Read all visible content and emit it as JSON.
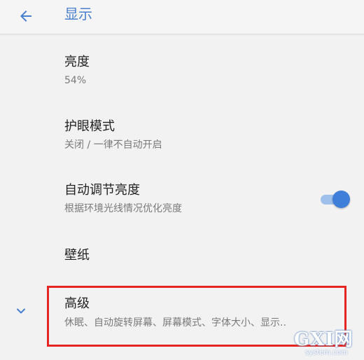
{
  "app_bar": {
    "title": "显示",
    "back_icon": "arrow-back-icon",
    "accent_color": "#4a7fd0"
  },
  "settings": {
    "brightness": {
      "title": "亮度",
      "value": "54%"
    },
    "night_light": {
      "title": "护眼模式",
      "summary": "关闭 / 一律不自动开启"
    },
    "adaptive_brightness": {
      "title": "自动调节亮度",
      "summary": "根据环境光线情况优化亮度",
      "toggle_on": true,
      "toggle_color": "#3f7fd9"
    },
    "wallpaper": {
      "title": "壁纸"
    },
    "advanced": {
      "title": "高级",
      "summary": "休眠、自动旋转屏幕、屏幕模式、字体大小、显示..",
      "expand_icon": "chevron-down-icon",
      "highlight_color": "#e52521"
    }
  },
  "watermark": {
    "text": "GXI网",
    "subtext": "system.com"
  }
}
